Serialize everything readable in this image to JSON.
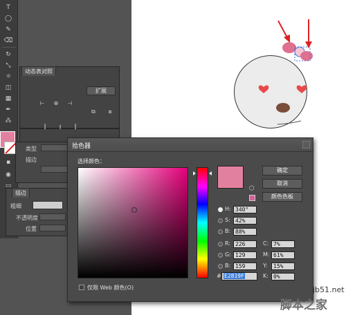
{
  "layers_panel": {
    "tab_label": "动态表对照",
    "button_label": "扩展"
  },
  "appearance_panel": {
    "type_label": "类型",
    "stroke_label": "描边",
    "section_title": "描边",
    "weight_label": "粗细",
    "opacity_label": "不透明度",
    "position_label": "位置"
  },
  "color_picker": {
    "title": "拾色器",
    "select_color_label": "选择颜色：",
    "ok_button": "确定",
    "cancel_button": "取消",
    "swatches_button": "颜色色板",
    "fields": {
      "h": {
        "label": "H:",
        "value": "340°"
      },
      "s": {
        "label": "S:",
        "value": "42%"
      },
      "b": {
        "label": "B:",
        "value": "88%"
      },
      "r": {
        "label": "R:",
        "value": "226"
      },
      "g": {
        "label": "G:",
        "value": "129"
      },
      "b2": {
        "label": "B:",
        "value": "159"
      },
      "c": {
        "label": "C:",
        "value": "7%"
      },
      "m": {
        "label": "M:",
        "value": "61%"
      },
      "y": {
        "label": "Y:",
        "value": "15%"
      },
      "k": {
        "label": "K:",
        "value": "0%"
      }
    },
    "hash_label": "#",
    "hex_value": "E2819F",
    "web_only_label": "仅限 Web 颜色(O)",
    "selected_color": "#e2819f",
    "hue_degrees": 340
  },
  "watermark": {
    "domain": "jb51.net",
    "brand": "脚本之家"
  },
  "colors": {
    "workspace": "#535353",
    "panel": "#434343",
    "selected_pink": "#e2819f",
    "arrow_red": "#e02020"
  }
}
